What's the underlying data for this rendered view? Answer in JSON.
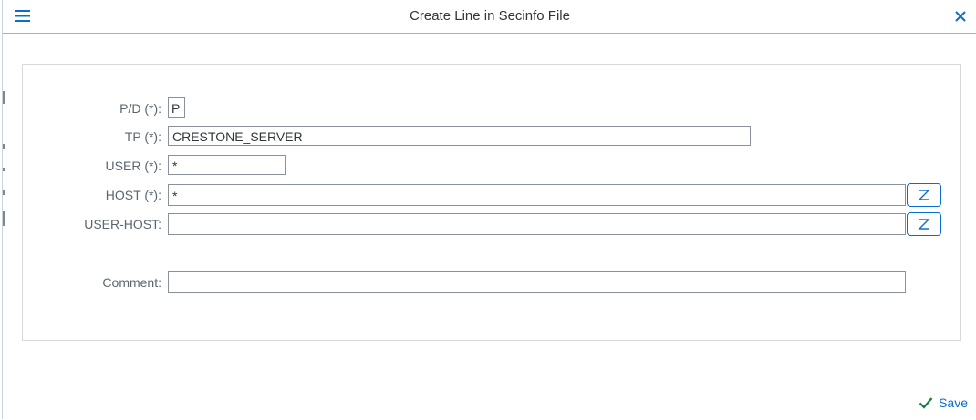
{
  "dialog": {
    "title": "Create Line in Secinfo File"
  },
  "form": {
    "pd": {
      "label": "P/D (*):",
      "value": "P"
    },
    "tp": {
      "label": "TP (*):",
      "value": "CRESTONE_SERVER"
    },
    "user": {
      "label": "USER (*):",
      "value": "*"
    },
    "host": {
      "label": "HOST (*):",
      "value": "*"
    },
    "user_host": {
      "label": "USER-HOST:",
      "value": ""
    },
    "comment": {
      "label": "Comment:",
      "value": ""
    }
  },
  "footer": {
    "save_label": "Save"
  },
  "colors": {
    "accent": "#0a6ed1",
    "save_check": "#107e3e"
  },
  "icons": {
    "menu": "hamburger-menu-icon",
    "close": "close-icon",
    "value_help": "value-help-icon",
    "save": "checkmark-icon"
  }
}
